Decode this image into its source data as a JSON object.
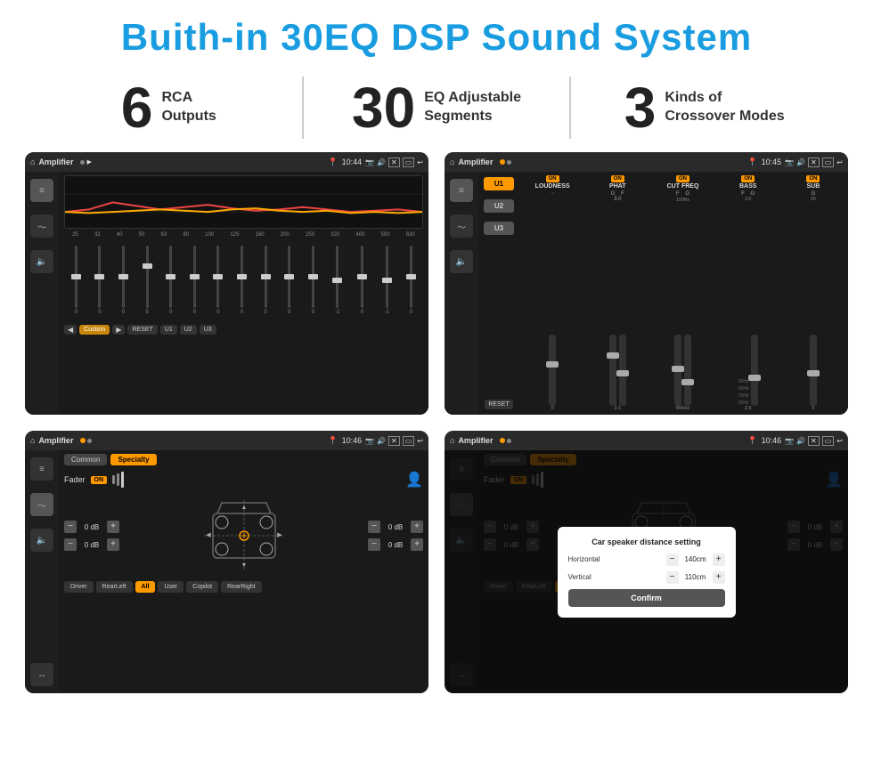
{
  "title": "Buith-in 30EQ DSP Sound System",
  "stats": [
    {
      "number": "6",
      "label": "RCA\nOutputs"
    },
    {
      "number": "30",
      "label": "EQ Adjustable\nSegments"
    },
    {
      "number": "3",
      "label": "Kinds of\nCrossover Modes"
    }
  ],
  "screen1": {
    "topbar": {
      "title": "Amplifier",
      "time": "10:44"
    },
    "frequencies": [
      "25",
      "32",
      "40",
      "50",
      "63",
      "80",
      "100",
      "125",
      "160",
      "200",
      "250",
      "320",
      "400",
      "500",
      "630"
    ],
    "sliderValues": [
      "0",
      "0",
      "0",
      "5",
      "0",
      "0",
      "0",
      "0",
      "0",
      "0",
      "0",
      "-1",
      "0",
      "-1"
    ],
    "buttons": [
      "Custom",
      "RESET",
      "U1",
      "U2",
      "U3"
    ]
  },
  "screen2": {
    "topbar": {
      "title": "Amplifier",
      "time": "10:45"
    },
    "uButtons": [
      "U1",
      "U2",
      "U3"
    ],
    "cols": [
      {
        "label": "LOUDNESS"
      },
      {
        "label": "PHAT"
      },
      {
        "label": "CUT FREQ"
      },
      {
        "label": "BASS"
      },
      {
        "label": "SUB"
      }
    ]
  },
  "screen3": {
    "topbar": {
      "title": "Amplifier",
      "time": "10:46"
    },
    "tabs": [
      "Common",
      "Specialty"
    ],
    "faderLabel": "Fader",
    "dbValues": [
      "0 dB",
      "0 dB",
      "0 dB",
      "0 dB"
    ],
    "bottomBtns": [
      "Driver",
      "RearLeft",
      "All",
      "User",
      "Copilot",
      "RearRight"
    ]
  },
  "screen4": {
    "topbar": {
      "title": "Amplifier",
      "time": "10:46"
    },
    "tabs": [
      "Common",
      "Specialty"
    ],
    "dialog": {
      "title": "Car speaker distance setting",
      "horizontal": {
        "label": "Horizontal",
        "value": "140cm"
      },
      "vertical": {
        "label": "Vertical",
        "value": "110cm"
      },
      "confirmBtn": "Confirm"
    },
    "dbValues": [
      "0 dB",
      "0 dB"
    ],
    "bottomBtns": [
      "Driver",
      "RearLeft",
      "All",
      "User",
      "Copilot",
      "RearRight"
    ]
  },
  "icons": {
    "home": "⌂",
    "location": "📍",
    "camera": "📷",
    "volume": "🔊",
    "back": "↩",
    "equalizer": "≡",
    "waveform": "〜",
    "speaker": "🔈",
    "person": "👤"
  }
}
